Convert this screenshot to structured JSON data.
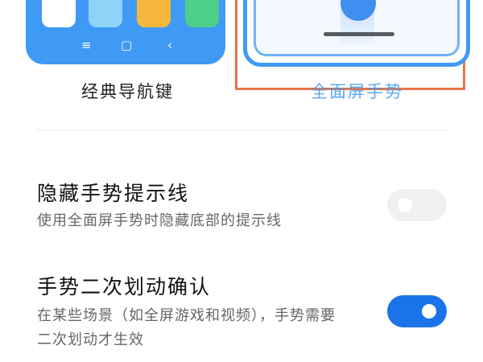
{
  "colors": {
    "accent": "#3f9af6",
    "highlight_border": "#e67449",
    "toggle_on": "#1a73e8",
    "toggle_off": "#f0f0f0"
  },
  "nav_options": {
    "classic": {
      "label": "经典导航键",
      "app_icon_colors": [
        "#ffffff",
        "#8fd3f8",
        "#f6b63b",
        "#4ccf86"
      ],
      "keys": [
        "≡",
        "▢",
        "‹"
      ]
    },
    "gestures": {
      "label": "全面屏手势",
      "selected": true
    }
  },
  "settings": {
    "hide_indicator": {
      "title": "隐藏手势提示线",
      "description": "使用全面屏手势时隐藏底部的提示线",
      "enabled": false
    },
    "confirm_swipe": {
      "title": "手势二次划动确认",
      "description_line1": "在某些场景（如全屏游戏和视频），手势需要",
      "description_line2": "二次划动才生效",
      "enabled": true
    }
  }
}
